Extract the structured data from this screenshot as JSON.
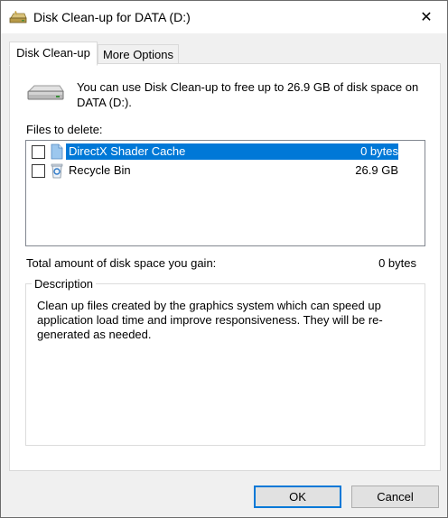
{
  "window": {
    "title": "Disk Clean-up for DATA (D:)",
    "close_symbol": "✕"
  },
  "tabs": [
    {
      "label": "Disk Clean-up",
      "active": true
    },
    {
      "label": "More Options",
      "active": false
    }
  ],
  "intro_text": "You can use Disk Clean-up to free up to 26.9 GB of disk space on DATA (D:).",
  "files_label": "Files to delete:",
  "files": [
    {
      "name": "DirectX Shader Cache",
      "size": "0 bytes",
      "checked": false,
      "selected": true,
      "icon": "page-icon"
    },
    {
      "name": "Recycle Bin",
      "size": "26.9 GB",
      "checked": false,
      "selected": false,
      "icon": "recycle-bin-icon"
    }
  ],
  "total_label": "Total amount of disk space you gain:",
  "total_value": "0 bytes",
  "description": {
    "legend": "Description",
    "text": "Clean up files created by the graphics system which can speed up application load time and improve responsiveness. They will be re-generated as needed."
  },
  "buttons": {
    "ok": "OK",
    "cancel": "Cancel"
  },
  "colors": {
    "selection": "#0078d7",
    "panel_bg": "#ffffff",
    "dialog_bg": "#f0f0f0"
  }
}
